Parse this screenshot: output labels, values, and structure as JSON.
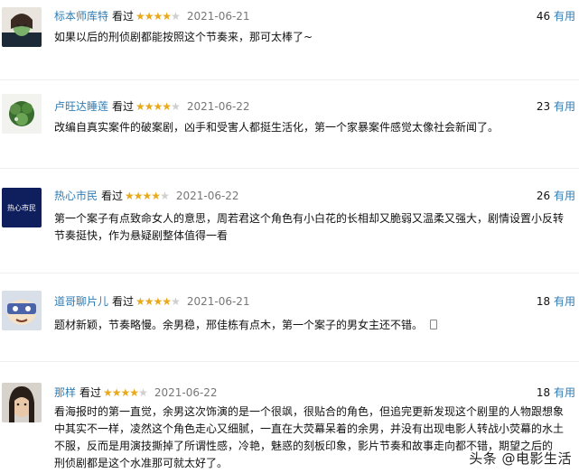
{
  "reviews": [
    {
      "user": "标本师库特",
      "watched": "看过",
      "stars_on": "★★★★",
      "stars_off": "★",
      "date": "2021-06-21",
      "useful_count": "46",
      "useful_label": "有用",
      "content": "如果以后的刑侦剧都能按照这个节奏来，那可太棒了~",
      "avatar_icon": "woman-face-avatar"
    },
    {
      "user": "卢旺达睡莲",
      "watched": "看过",
      "stars_on": "★★★★",
      "stars_off": "★",
      "date": "2021-06-22",
      "useful_count": "23",
      "useful_label": "有用",
      "content": "改编自真实案件的破案剧，凶手和受害人都挺生活化，第一个家暴案件感觉太像社会新闻了。",
      "avatar_icon": "plant-leaves-avatar"
    },
    {
      "user": "热心市民",
      "watched": "看过",
      "stars_on": "★★★★",
      "stars_off": "★",
      "date": "2021-06-22",
      "useful_count": "26",
      "useful_label": "有用",
      "content": "第一个案子有点致命女人的意思，周若君这个角色有小白花的长相却又脆弱又温柔又强大，剧情设置小反转\n节奏挺快，作为悬疑剧整体值得一看",
      "avatar_text": "热心市民",
      "avatar_icon": "text-logo-avatar"
    },
    {
      "user": "道哥聊片儿",
      "watched": "看过",
      "stars_on": "★★★★",
      "stars_off": "★",
      "date": "2021-06-21",
      "useful_count": "18",
      "useful_label": "有用",
      "content": "题材新颖，节奏略慢。余男稳，邢佳栋有点木，第一个案子的男女主还不错。",
      "avatar_icon": "cartoon-face-avatar"
    },
    {
      "user": "那样",
      "watched": "看过",
      "stars_on": "★★★★",
      "stars_off": "★",
      "date": "2021-06-22",
      "useful_count": "18",
      "useful_label": "有用",
      "content": "看海报时的第一直觉，余男这次饰演的是一个很飒，很贴合的角色，但追完更新发现这个剧里的人物跟想象\n中其实不一样，凌然这个角色走心又细腻，一直在大荧幕呆着的余男，并没有出现电影人转战小荧幕的水土\n不服，反而是用演技撕掉了所谓性感，冷艳，魅惑的刻板印象，影片节奏和故事走向都不错，期望之后的\n刑侦剧都是这个水准那可就太好了。",
      "avatar_icon": "person-photo-avatar"
    }
  ],
  "watermark": {
    "text": "头条 @电影生活"
  },
  "colors": {
    "link": "#2f7db5",
    "star": "#e8a91b",
    "star_off": "#cfcfcf"
  }
}
